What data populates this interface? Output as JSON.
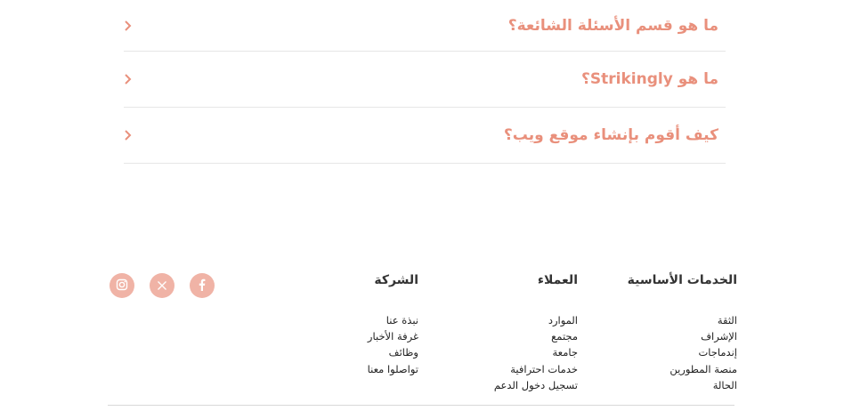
{
  "faq": {
    "items": [
      {
        "question": "ما هو قسم الأسئلة الشائعة؟"
      },
      {
        "question": "ما هو Strikingly؟"
      },
      {
        "question": "كيف أقوم بإنشاء موقع ويب؟"
      }
    ]
  },
  "footer": {
    "columns": [
      {
        "title": "الخدمات الأساسية",
        "links": [
          "الثقة",
          "الإشراف",
          "إندماجات",
          "منصة المطورين",
          "الحالة"
        ]
      },
      {
        "title": "العملاء",
        "links": [
          "الموارد",
          "مجتمع",
          "جامعة",
          "خدمات احترافية",
          "تسجيل دخول الدعم"
        ]
      },
      {
        "title": "الشركة",
        "links": [
          "نبذة عنا",
          "غرفة الأخبار",
          "وظائف",
          "تواصلوا معنا"
        ]
      }
    ],
    "social": [
      "facebook-icon",
      "x-icon",
      "instagram-icon"
    ]
  },
  "colors": {
    "accent": "#e9907c",
    "social_bg": "#f0b3a6"
  }
}
